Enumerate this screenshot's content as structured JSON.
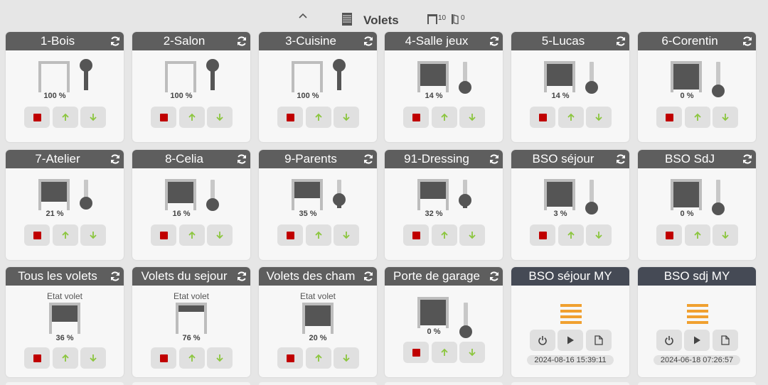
{
  "header": {
    "title": "Volets",
    "open_count": "10",
    "closed_count": "0"
  },
  "shutters": [
    {
      "name": "1-Bois",
      "percent": 100,
      "percent_label": "100 %"
    },
    {
      "name": "2-Salon",
      "percent": 100,
      "percent_label": "100 %"
    },
    {
      "name": "3-Cuisine",
      "percent": 100,
      "percent_label": "100 %"
    },
    {
      "name": "4-Salle jeux",
      "percent": 14,
      "percent_label": "14 %"
    },
    {
      "name": "5-Lucas",
      "percent": 14,
      "percent_label": "14 %"
    },
    {
      "name": "6-Corentin",
      "percent": 0,
      "percent_label": "0 %"
    },
    {
      "name": "7-Atelier",
      "percent": 21,
      "percent_label": "21 %"
    },
    {
      "name": "8-Celia",
      "percent": 16,
      "percent_label": "16 %"
    },
    {
      "name": "9-Parents",
      "percent": 35,
      "percent_label": "35 %"
    },
    {
      "name": "91-Dressing",
      "percent": 32,
      "percent_label": "32 %"
    },
    {
      "name": "BSO séjour",
      "percent": 3,
      "percent_label": "3 %"
    },
    {
      "name": "BSO SdJ",
      "percent": 0,
      "percent_label": "0 %"
    }
  ],
  "groups": [
    {
      "name": "Tous les volets",
      "state_label": "Etat volet",
      "percent": 36,
      "percent_label": "36 %"
    },
    {
      "name": "Volets du sejour",
      "state_label": "Etat volet",
      "percent": 76,
      "percent_label": "76 %"
    },
    {
      "name": "Volets des cham",
      "state_label": "Etat volet",
      "percent": 20,
      "percent_label": "20 %"
    }
  ],
  "garage": {
    "name": "Porte de garage",
    "percent": 0,
    "percent_label": "0 %"
  },
  "bso_my": [
    {
      "name": "BSO séjour MY",
      "timestamp": "2024-08-16 15:39:11"
    },
    {
      "name": "BSO sdj MY",
      "timestamp": "2024-06-18 07:26:57"
    }
  ],
  "colors": {
    "header": "#5e5e5e",
    "header_dark": "#454a55",
    "stop": "#c00000",
    "arrow": "#8cc63f",
    "bso_accent": "#f0a030"
  },
  "icons": [
    "chevron-up-icon",
    "shutter-icon",
    "refresh-icon",
    "stop-icon",
    "arrow-up-icon",
    "arrow-down-icon",
    "power-icon",
    "play-icon",
    "document-icon"
  ]
}
